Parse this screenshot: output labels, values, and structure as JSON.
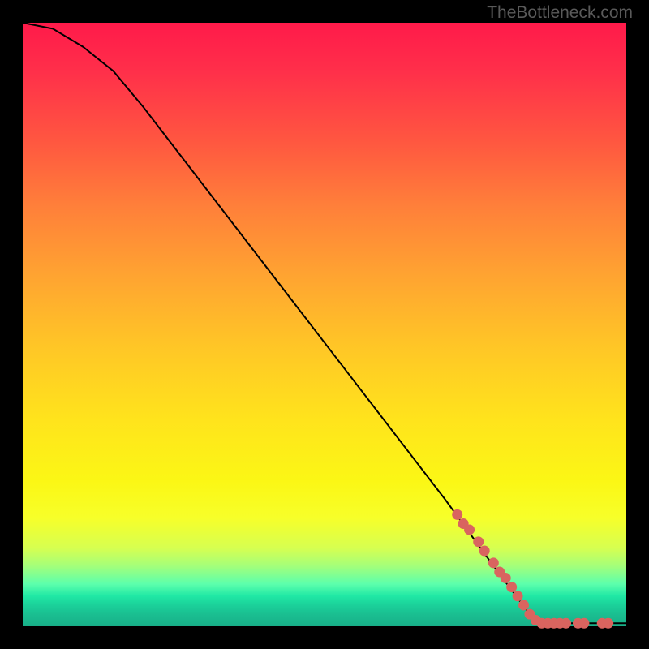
{
  "watermark": "TheBottleneck.com",
  "chart_data": {
    "type": "line",
    "title": "",
    "xlabel": "",
    "ylabel": "",
    "xlim": [
      0,
      100
    ],
    "ylim": [
      0,
      100
    ],
    "curve": [
      {
        "x": 0,
        "y": 100
      },
      {
        "x": 5,
        "y": 99
      },
      {
        "x": 10,
        "y": 96
      },
      {
        "x": 15,
        "y": 92
      },
      {
        "x": 20,
        "y": 86
      },
      {
        "x": 30,
        "y": 73
      },
      {
        "x": 40,
        "y": 60
      },
      {
        "x": 50,
        "y": 47
      },
      {
        "x": 60,
        "y": 34
      },
      {
        "x": 70,
        "y": 21
      },
      {
        "x": 78,
        "y": 10
      },
      {
        "x": 84,
        "y": 2
      },
      {
        "x": 86,
        "y": 0.5
      },
      {
        "x": 100,
        "y": 0.5
      }
    ],
    "markers": [
      {
        "x": 72,
        "y": 18.5
      },
      {
        "x": 73,
        "y": 17
      },
      {
        "x": 74,
        "y": 16
      },
      {
        "x": 75.5,
        "y": 14
      },
      {
        "x": 76.5,
        "y": 12.5
      },
      {
        "x": 78,
        "y": 10.5
      },
      {
        "x": 79,
        "y": 9
      },
      {
        "x": 80,
        "y": 8
      },
      {
        "x": 81,
        "y": 6.5
      },
      {
        "x": 82,
        "y": 5
      },
      {
        "x": 83,
        "y": 3.5
      },
      {
        "x": 84,
        "y": 2
      },
      {
        "x": 85,
        "y": 1
      },
      {
        "x": 86,
        "y": 0.5
      },
      {
        "x": 87,
        "y": 0.5
      },
      {
        "x": 88,
        "y": 0.5
      },
      {
        "x": 89,
        "y": 0.5
      },
      {
        "x": 90,
        "y": 0.5
      },
      {
        "x": 92,
        "y": 0.5
      },
      {
        "x": 93,
        "y": 0.5
      },
      {
        "x": 96,
        "y": 0.5
      },
      {
        "x": 97,
        "y": 0.5
      }
    ],
    "marker_color": "#d9645f",
    "line_color": "#000000"
  }
}
